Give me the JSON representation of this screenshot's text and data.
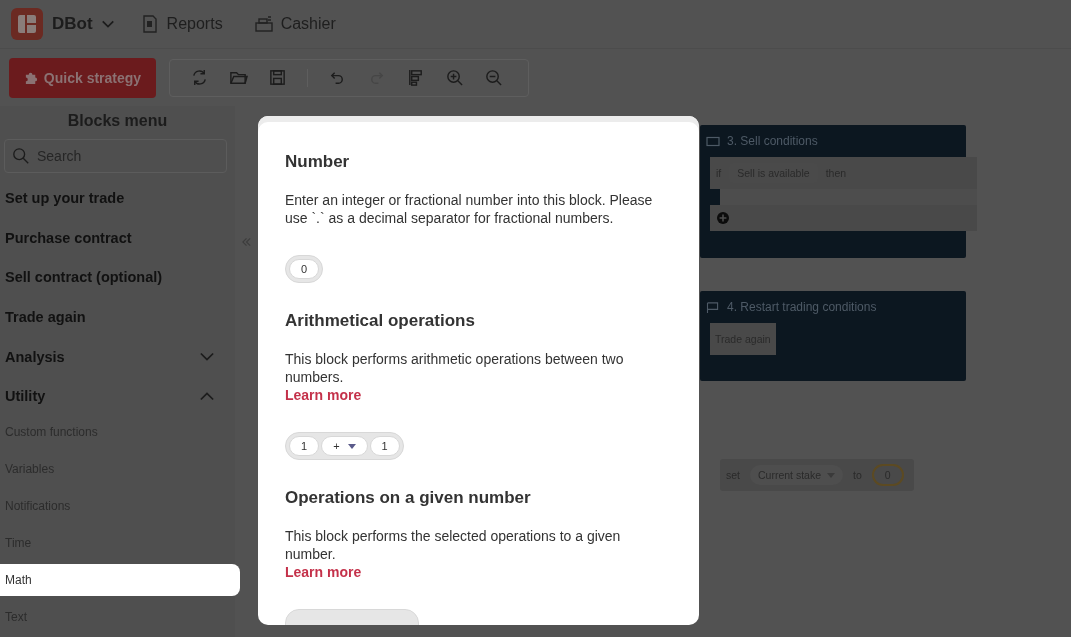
{
  "app": {
    "name": "DBot"
  },
  "nav": [
    {
      "label": "Reports",
      "kind": "report"
    },
    {
      "label": "Cashier",
      "kind": "cashier"
    }
  ],
  "quick_strategy": {
    "label": "Quick strategy"
  },
  "toolbar": [
    {
      "kind": "reset",
      "disabled": false
    },
    {
      "kind": "open",
      "disabled": false
    },
    {
      "kind": "save",
      "disabled": false
    },
    {
      "kind": "undo",
      "disabled": false
    },
    {
      "kind": "redo",
      "disabled": true
    },
    {
      "kind": "sort",
      "disabled": false
    },
    {
      "kind": "zoom-in",
      "disabled": false
    },
    {
      "kind": "zoom-out",
      "disabled": false
    }
  ],
  "sidebar": {
    "title": "Blocks menu",
    "search": {
      "placeholder": "Search"
    },
    "categories": [
      {
        "label": "Set up your trade"
      },
      {
        "label": "Purchase contract"
      },
      {
        "label": "Sell contract (optional)"
      },
      {
        "label": "Trade again"
      },
      {
        "label": "Analysis",
        "expanded": false
      },
      {
        "label": "Utility",
        "expanded": true,
        "children": [
          {
            "label": "Custom functions",
            "selected": false
          },
          {
            "label": "Variables",
            "selected": false
          },
          {
            "label": "Notifications",
            "selected": false
          },
          {
            "label": "Time",
            "selected": false
          },
          {
            "label": "Math",
            "selected": true
          },
          {
            "label": "Text",
            "selected": false
          }
        ]
      }
    ]
  },
  "help": {
    "sections": [
      {
        "title": "Number",
        "text": "Enter an integer or fractional number into this block. Please use `.` as a decimal separator for fractional numbers.",
        "example": {
          "kind": "number",
          "values": [
            "0"
          ]
        }
      },
      {
        "title": "Arithmetical operations",
        "text": "This block performs arithmetic operations between two numbers.",
        "learn_more": "Learn more",
        "example": {
          "kind": "arithmetic",
          "values": [
            "1",
            "+",
            "1"
          ]
        }
      },
      {
        "title": "Operations on a given number",
        "text": "This block performs the selected operations to a given number.",
        "learn_more": "Learn more",
        "example": {
          "kind": "cut"
        }
      }
    ]
  },
  "canvas": {
    "sell_block": {
      "title": "3. Sell conditions",
      "if": "if",
      "condition": "Sell is available",
      "then": "then"
    },
    "restart_block": {
      "title": "4. Restart trading conditions",
      "statement": "Trade again"
    },
    "set_block": {
      "set": "set",
      "variable": "Current stake",
      "to": "to",
      "value": "0"
    }
  }
}
